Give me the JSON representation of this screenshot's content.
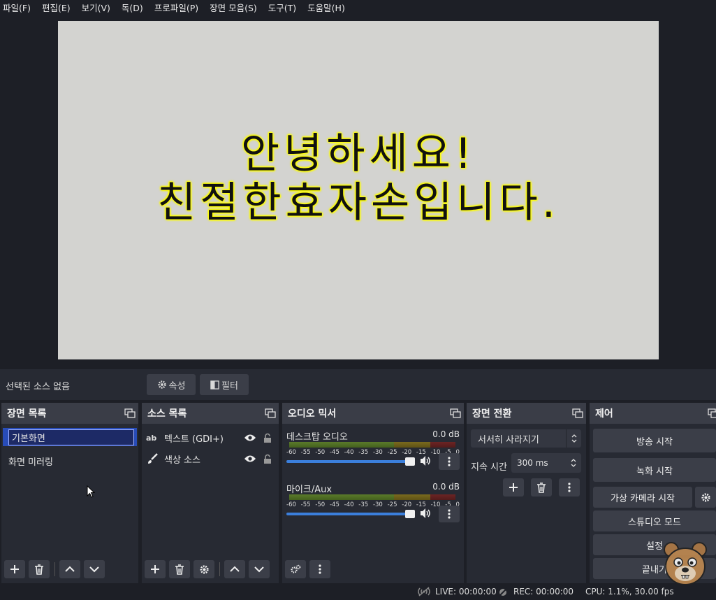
{
  "menu": [
    "파일(F)",
    "편집(E)",
    "보기(V)",
    "독(D)",
    "프로파일(P)",
    "장면 모음(S)",
    "도구(T)",
    "도움말(H)"
  ],
  "preview": {
    "line1": "안녕하세요!",
    "line2": "친절한효자손입니다."
  },
  "source_toolbar": {
    "no_source": "선택된 소스 없음",
    "properties": "속성",
    "filters": "필터"
  },
  "scenes": {
    "title": "장면 목록",
    "items": [
      "기본화면",
      "화면 미러링"
    ]
  },
  "sources": {
    "title": "소스 목록",
    "items": [
      {
        "icon": "ab",
        "name": "텍스트 (GDI+)"
      },
      {
        "icon": "brush",
        "name": "색상 소스"
      }
    ]
  },
  "mixer": {
    "title": "오디오 믹서",
    "ticks": [
      "-60",
      "-55",
      "-50",
      "-45",
      "-40",
      "-35",
      "-30",
      "-25",
      "-20",
      "-15",
      "-10",
      "-5",
      "0"
    ],
    "channels": [
      {
        "name": "데스크탑 오디오",
        "db": "0.0 dB",
        "volume": 1.0
      },
      {
        "name": "마이크/Aux",
        "db": "0.0 dB",
        "volume": 1.0
      }
    ]
  },
  "transitions": {
    "title": "장면 전환",
    "selected": "서서히 사라지기",
    "duration_label": "지속 시간",
    "duration_value": "300 ms"
  },
  "controls": {
    "title": "제어",
    "stream": "방송 시작",
    "record": "녹화 시작",
    "virtual_cam": "가상 카메라 시작",
    "studio": "스튜디오 모드",
    "settings": "설정",
    "exit": "끝내기"
  },
  "status": {
    "live": "LIVE: 00:00:00",
    "rec": "REC: 00:00:00",
    "cpu": "CPU: 1.1%, 30.00 fps"
  }
}
